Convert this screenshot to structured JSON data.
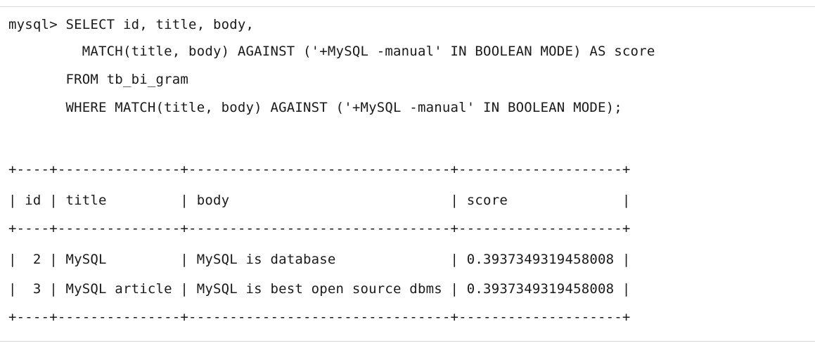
{
  "terminal": {
    "query": {
      "line1": "mysql> SELECT id, title, body,",
      "line2": "         MATCH(title, body) AGAINST ('+MySQL -manual' IN BOOLEAN MODE) AS score",
      "line3": "       FROM tb_bi_gram",
      "line4": "       WHERE MATCH(title, body) AGAINST ('+MySQL -manual' IN BOOLEAN MODE);"
    },
    "result_table": {
      "border": "+----+---------------+--------------------------------+--------------------+",
      "columns": [
        "id",
        "title",
        "body",
        "score"
      ],
      "header_row": "| id | title         | body                           | score              |",
      "rows": [
        {
          "id": "2",
          "title": "MySQL",
          "body": "MySQL is database",
          "score": "0.3937349319458008",
          "line": "|  2 | MySQL         | MySQL is database              | 0.3937349319458008 |"
        },
        {
          "id": "3",
          "title": "MySQL article",
          "body": "MySQL is best open source dbms",
          "score": "0.3937349319458008",
          "line": "|  3 | MySQL article | MySQL is best open source dbms | 0.3937349319458008 |"
        }
      ]
    }
  }
}
